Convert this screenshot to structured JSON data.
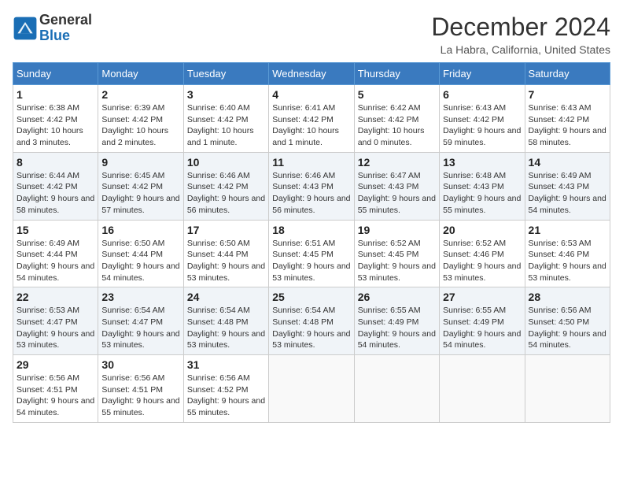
{
  "header": {
    "logo_general": "General",
    "logo_blue": "Blue",
    "month_title": "December 2024",
    "location": "La Habra, California, United States"
  },
  "days_of_week": [
    "Sunday",
    "Monday",
    "Tuesday",
    "Wednesday",
    "Thursday",
    "Friday",
    "Saturday"
  ],
  "weeks": [
    [
      {
        "day": "1",
        "sunrise": "Sunrise: 6:38 AM",
        "sunset": "Sunset: 4:42 PM",
        "daylight": "Daylight: 10 hours and 3 minutes."
      },
      {
        "day": "2",
        "sunrise": "Sunrise: 6:39 AM",
        "sunset": "Sunset: 4:42 PM",
        "daylight": "Daylight: 10 hours and 2 minutes."
      },
      {
        "day": "3",
        "sunrise": "Sunrise: 6:40 AM",
        "sunset": "Sunset: 4:42 PM",
        "daylight": "Daylight: 10 hours and 1 minute."
      },
      {
        "day": "4",
        "sunrise": "Sunrise: 6:41 AM",
        "sunset": "Sunset: 4:42 PM",
        "daylight": "Daylight: 10 hours and 1 minute."
      },
      {
        "day": "5",
        "sunrise": "Sunrise: 6:42 AM",
        "sunset": "Sunset: 4:42 PM",
        "daylight": "Daylight: 10 hours and 0 minutes."
      },
      {
        "day": "6",
        "sunrise": "Sunrise: 6:43 AM",
        "sunset": "Sunset: 4:42 PM",
        "daylight": "Daylight: 9 hours and 59 minutes."
      },
      {
        "day": "7",
        "sunrise": "Sunrise: 6:43 AM",
        "sunset": "Sunset: 4:42 PM",
        "daylight": "Daylight: 9 hours and 58 minutes."
      }
    ],
    [
      {
        "day": "8",
        "sunrise": "Sunrise: 6:44 AM",
        "sunset": "Sunset: 4:42 PM",
        "daylight": "Daylight: 9 hours and 58 minutes."
      },
      {
        "day": "9",
        "sunrise": "Sunrise: 6:45 AM",
        "sunset": "Sunset: 4:42 PM",
        "daylight": "Daylight: 9 hours and 57 minutes."
      },
      {
        "day": "10",
        "sunrise": "Sunrise: 6:46 AM",
        "sunset": "Sunset: 4:42 PM",
        "daylight": "Daylight: 9 hours and 56 minutes."
      },
      {
        "day": "11",
        "sunrise": "Sunrise: 6:46 AM",
        "sunset": "Sunset: 4:43 PM",
        "daylight": "Daylight: 9 hours and 56 minutes."
      },
      {
        "day": "12",
        "sunrise": "Sunrise: 6:47 AM",
        "sunset": "Sunset: 4:43 PM",
        "daylight": "Daylight: 9 hours and 55 minutes."
      },
      {
        "day": "13",
        "sunrise": "Sunrise: 6:48 AM",
        "sunset": "Sunset: 4:43 PM",
        "daylight": "Daylight: 9 hours and 55 minutes."
      },
      {
        "day": "14",
        "sunrise": "Sunrise: 6:49 AM",
        "sunset": "Sunset: 4:43 PM",
        "daylight": "Daylight: 9 hours and 54 minutes."
      }
    ],
    [
      {
        "day": "15",
        "sunrise": "Sunrise: 6:49 AM",
        "sunset": "Sunset: 4:44 PM",
        "daylight": "Daylight: 9 hours and 54 minutes."
      },
      {
        "day": "16",
        "sunrise": "Sunrise: 6:50 AM",
        "sunset": "Sunset: 4:44 PM",
        "daylight": "Daylight: 9 hours and 54 minutes."
      },
      {
        "day": "17",
        "sunrise": "Sunrise: 6:50 AM",
        "sunset": "Sunset: 4:44 PM",
        "daylight": "Daylight: 9 hours and 53 minutes."
      },
      {
        "day": "18",
        "sunrise": "Sunrise: 6:51 AM",
        "sunset": "Sunset: 4:45 PM",
        "daylight": "Daylight: 9 hours and 53 minutes."
      },
      {
        "day": "19",
        "sunrise": "Sunrise: 6:52 AM",
        "sunset": "Sunset: 4:45 PM",
        "daylight": "Daylight: 9 hours and 53 minutes."
      },
      {
        "day": "20",
        "sunrise": "Sunrise: 6:52 AM",
        "sunset": "Sunset: 4:46 PM",
        "daylight": "Daylight: 9 hours and 53 minutes."
      },
      {
        "day": "21",
        "sunrise": "Sunrise: 6:53 AM",
        "sunset": "Sunset: 4:46 PM",
        "daylight": "Daylight: 9 hours and 53 minutes."
      }
    ],
    [
      {
        "day": "22",
        "sunrise": "Sunrise: 6:53 AM",
        "sunset": "Sunset: 4:47 PM",
        "daylight": "Daylight: 9 hours and 53 minutes."
      },
      {
        "day": "23",
        "sunrise": "Sunrise: 6:54 AM",
        "sunset": "Sunset: 4:47 PM",
        "daylight": "Daylight: 9 hours and 53 minutes."
      },
      {
        "day": "24",
        "sunrise": "Sunrise: 6:54 AM",
        "sunset": "Sunset: 4:48 PM",
        "daylight": "Daylight: 9 hours and 53 minutes."
      },
      {
        "day": "25",
        "sunrise": "Sunrise: 6:54 AM",
        "sunset": "Sunset: 4:48 PM",
        "daylight": "Daylight: 9 hours and 53 minutes."
      },
      {
        "day": "26",
        "sunrise": "Sunrise: 6:55 AM",
        "sunset": "Sunset: 4:49 PM",
        "daylight": "Daylight: 9 hours and 54 minutes."
      },
      {
        "day": "27",
        "sunrise": "Sunrise: 6:55 AM",
        "sunset": "Sunset: 4:49 PM",
        "daylight": "Daylight: 9 hours and 54 minutes."
      },
      {
        "day": "28",
        "sunrise": "Sunrise: 6:56 AM",
        "sunset": "Sunset: 4:50 PM",
        "daylight": "Daylight: 9 hours and 54 minutes."
      }
    ],
    [
      {
        "day": "29",
        "sunrise": "Sunrise: 6:56 AM",
        "sunset": "Sunset: 4:51 PM",
        "daylight": "Daylight: 9 hours and 54 minutes."
      },
      {
        "day": "30",
        "sunrise": "Sunrise: 6:56 AM",
        "sunset": "Sunset: 4:51 PM",
        "daylight": "Daylight: 9 hours and 55 minutes."
      },
      {
        "day": "31",
        "sunrise": "Sunrise: 6:56 AM",
        "sunset": "Sunset: 4:52 PM",
        "daylight": "Daylight: 9 hours and 55 minutes."
      },
      null,
      null,
      null,
      null
    ]
  ]
}
